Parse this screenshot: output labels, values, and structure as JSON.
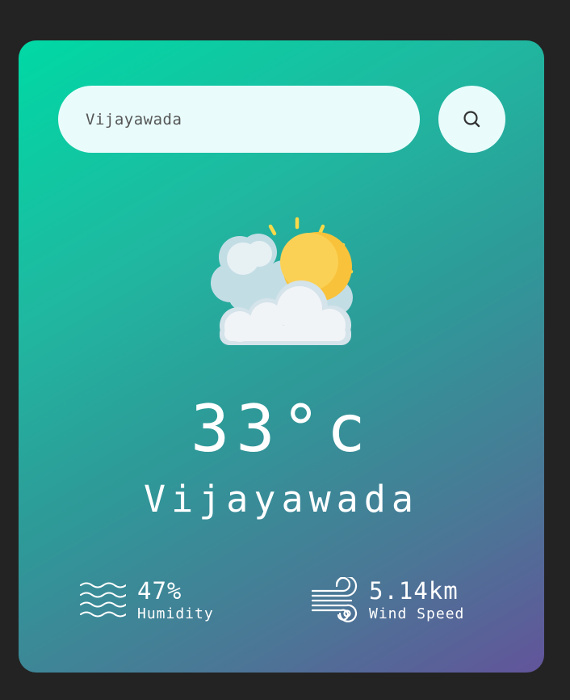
{
  "search": {
    "value": "Vijayawada",
    "icon": "search-icon"
  },
  "weather": {
    "icon": "partly-cloudy-sun-icon",
    "temperature": "33°c",
    "city": "Vijayawada"
  },
  "humidity": {
    "icon": "waves-icon",
    "value": "47%",
    "label": "Humidity"
  },
  "wind": {
    "icon": "wind-icon",
    "value": "5.14km",
    "label": "Wind Speed"
  },
  "colors": {
    "page_background": "#232323",
    "card_gradient_start": "#00d9a5",
    "card_gradient_end": "#62549a",
    "search_background": "#e9fcfb",
    "text": "#ffffff",
    "sun": "#f8c23a",
    "sun_rays": "#f7d949",
    "cloud": "#f1f4f7"
  }
}
